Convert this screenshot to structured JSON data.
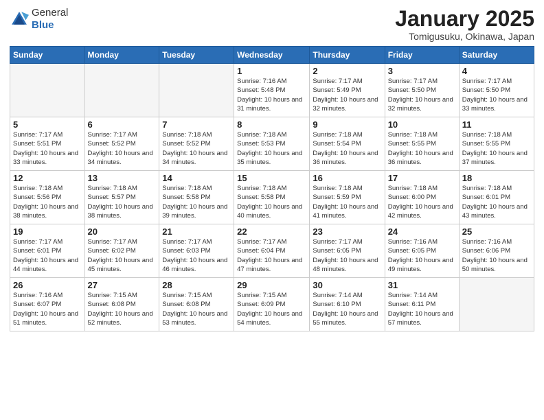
{
  "header": {
    "logo_general": "General",
    "logo_blue": "Blue",
    "month_title": "January 2025",
    "subtitle": "Tomigusuku, Okinawa, Japan"
  },
  "days_of_week": [
    "Sunday",
    "Monday",
    "Tuesday",
    "Wednesday",
    "Thursday",
    "Friday",
    "Saturday"
  ],
  "weeks": [
    [
      {
        "day": "",
        "empty": true
      },
      {
        "day": "",
        "empty": true
      },
      {
        "day": "",
        "empty": true
      },
      {
        "day": "1",
        "sunrise": "7:16 AM",
        "sunset": "5:48 PM",
        "daylight": "10 hours and 31 minutes."
      },
      {
        "day": "2",
        "sunrise": "7:17 AM",
        "sunset": "5:49 PM",
        "daylight": "10 hours and 32 minutes."
      },
      {
        "day": "3",
        "sunrise": "7:17 AM",
        "sunset": "5:50 PM",
        "daylight": "10 hours and 32 minutes."
      },
      {
        "day": "4",
        "sunrise": "7:17 AM",
        "sunset": "5:50 PM",
        "daylight": "10 hours and 33 minutes."
      }
    ],
    [
      {
        "day": "5",
        "sunrise": "7:17 AM",
        "sunset": "5:51 PM",
        "daylight": "10 hours and 33 minutes."
      },
      {
        "day": "6",
        "sunrise": "7:17 AM",
        "sunset": "5:52 PM",
        "daylight": "10 hours and 34 minutes."
      },
      {
        "day": "7",
        "sunrise": "7:18 AM",
        "sunset": "5:52 PM",
        "daylight": "10 hours and 34 minutes."
      },
      {
        "day": "8",
        "sunrise": "7:18 AM",
        "sunset": "5:53 PM",
        "daylight": "10 hours and 35 minutes."
      },
      {
        "day": "9",
        "sunrise": "7:18 AM",
        "sunset": "5:54 PM",
        "daylight": "10 hours and 36 minutes."
      },
      {
        "day": "10",
        "sunrise": "7:18 AM",
        "sunset": "5:55 PM",
        "daylight": "10 hours and 36 minutes."
      },
      {
        "day": "11",
        "sunrise": "7:18 AM",
        "sunset": "5:55 PM",
        "daylight": "10 hours and 37 minutes."
      }
    ],
    [
      {
        "day": "12",
        "sunrise": "7:18 AM",
        "sunset": "5:56 PM",
        "daylight": "10 hours and 38 minutes."
      },
      {
        "day": "13",
        "sunrise": "7:18 AM",
        "sunset": "5:57 PM",
        "daylight": "10 hours and 38 minutes."
      },
      {
        "day": "14",
        "sunrise": "7:18 AM",
        "sunset": "5:58 PM",
        "daylight": "10 hours and 39 minutes."
      },
      {
        "day": "15",
        "sunrise": "7:18 AM",
        "sunset": "5:58 PM",
        "daylight": "10 hours and 40 minutes."
      },
      {
        "day": "16",
        "sunrise": "7:18 AM",
        "sunset": "5:59 PM",
        "daylight": "10 hours and 41 minutes."
      },
      {
        "day": "17",
        "sunrise": "7:18 AM",
        "sunset": "6:00 PM",
        "daylight": "10 hours and 42 minutes."
      },
      {
        "day": "18",
        "sunrise": "7:18 AM",
        "sunset": "6:01 PM",
        "daylight": "10 hours and 43 minutes."
      }
    ],
    [
      {
        "day": "19",
        "sunrise": "7:17 AM",
        "sunset": "6:01 PM",
        "daylight": "10 hours and 44 minutes."
      },
      {
        "day": "20",
        "sunrise": "7:17 AM",
        "sunset": "6:02 PM",
        "daylight": "10 hours and 45 minutes."
      },
      {
        "day": "21",
        "sunrise": "7:17 AM",
        "sunset": "6:03 PM",
        "daylight": "10 hours and 46 minutes."
      },
      {
        "day": "22",
        "sunrise": "7:17 AM",
        "sunset": "6:04 PM",
        "daylight": "10 hours and 47 minutes."
      },
      {
        "day": "23",
        "sunrise": "7:17 AM",
        "sunset": "6:05 PM",
        "daylight": "10 hours and 48 minutes."
      },
      {
        "day": "24",
        "sunrise": "7:16 AM",
        "sunset": "6:05 PM",
        "daylight": "10 hours and 49 minutes."
      },
      {
        "day": "25",
        "sunrise": "7:16 AM",
        "sunset": "6:06 PM",
        "daylight": "10 hours and 50 minutes."
      }
    ],
    [
      {
        "day": "26",
        "sunrise": "7:16 AM",
        "sunset": "6:07 PM",
        "daylight": "10 hours and 51 minutes."
      },
      {
        "day": "27",
        "sunrise": "7:15 AM",
        "sunset": "6:08 PM",
        "daylight": "10 hours and 52 minutes."
      },
      {
        "day": "28",
        "sunrise": "7:15 AM",
        "sunset": "6:08 PM",
        "daylight": "10 hours and 53 minutes."
      },
      {
        "day": "29",
        "sunrise": "7:15 AM",
        "sunset": "6:09 PM",
        "daylight": "10 hours and 54 minutes."
      },
      {
        "day": "30",
        "sunrise": "7:14 AM",
        "sunset": "6:10 PM",
        "daylight": "10 hours and 55 minutes."
      },
      {
        "day": "31",
        "sunrise": "7:14 AM",
        "sunset": "6:11 PM",
        "daylight": "10 hours and 57 minutes."
      },
      {
        "day": "",
        "empty": true
      }
    ]
  ],
  "labels": {
    "sunrise": "Sunrise:",
    "sunset": "Sunset:",
    "daylight": "Daylight hours"
  }
}
